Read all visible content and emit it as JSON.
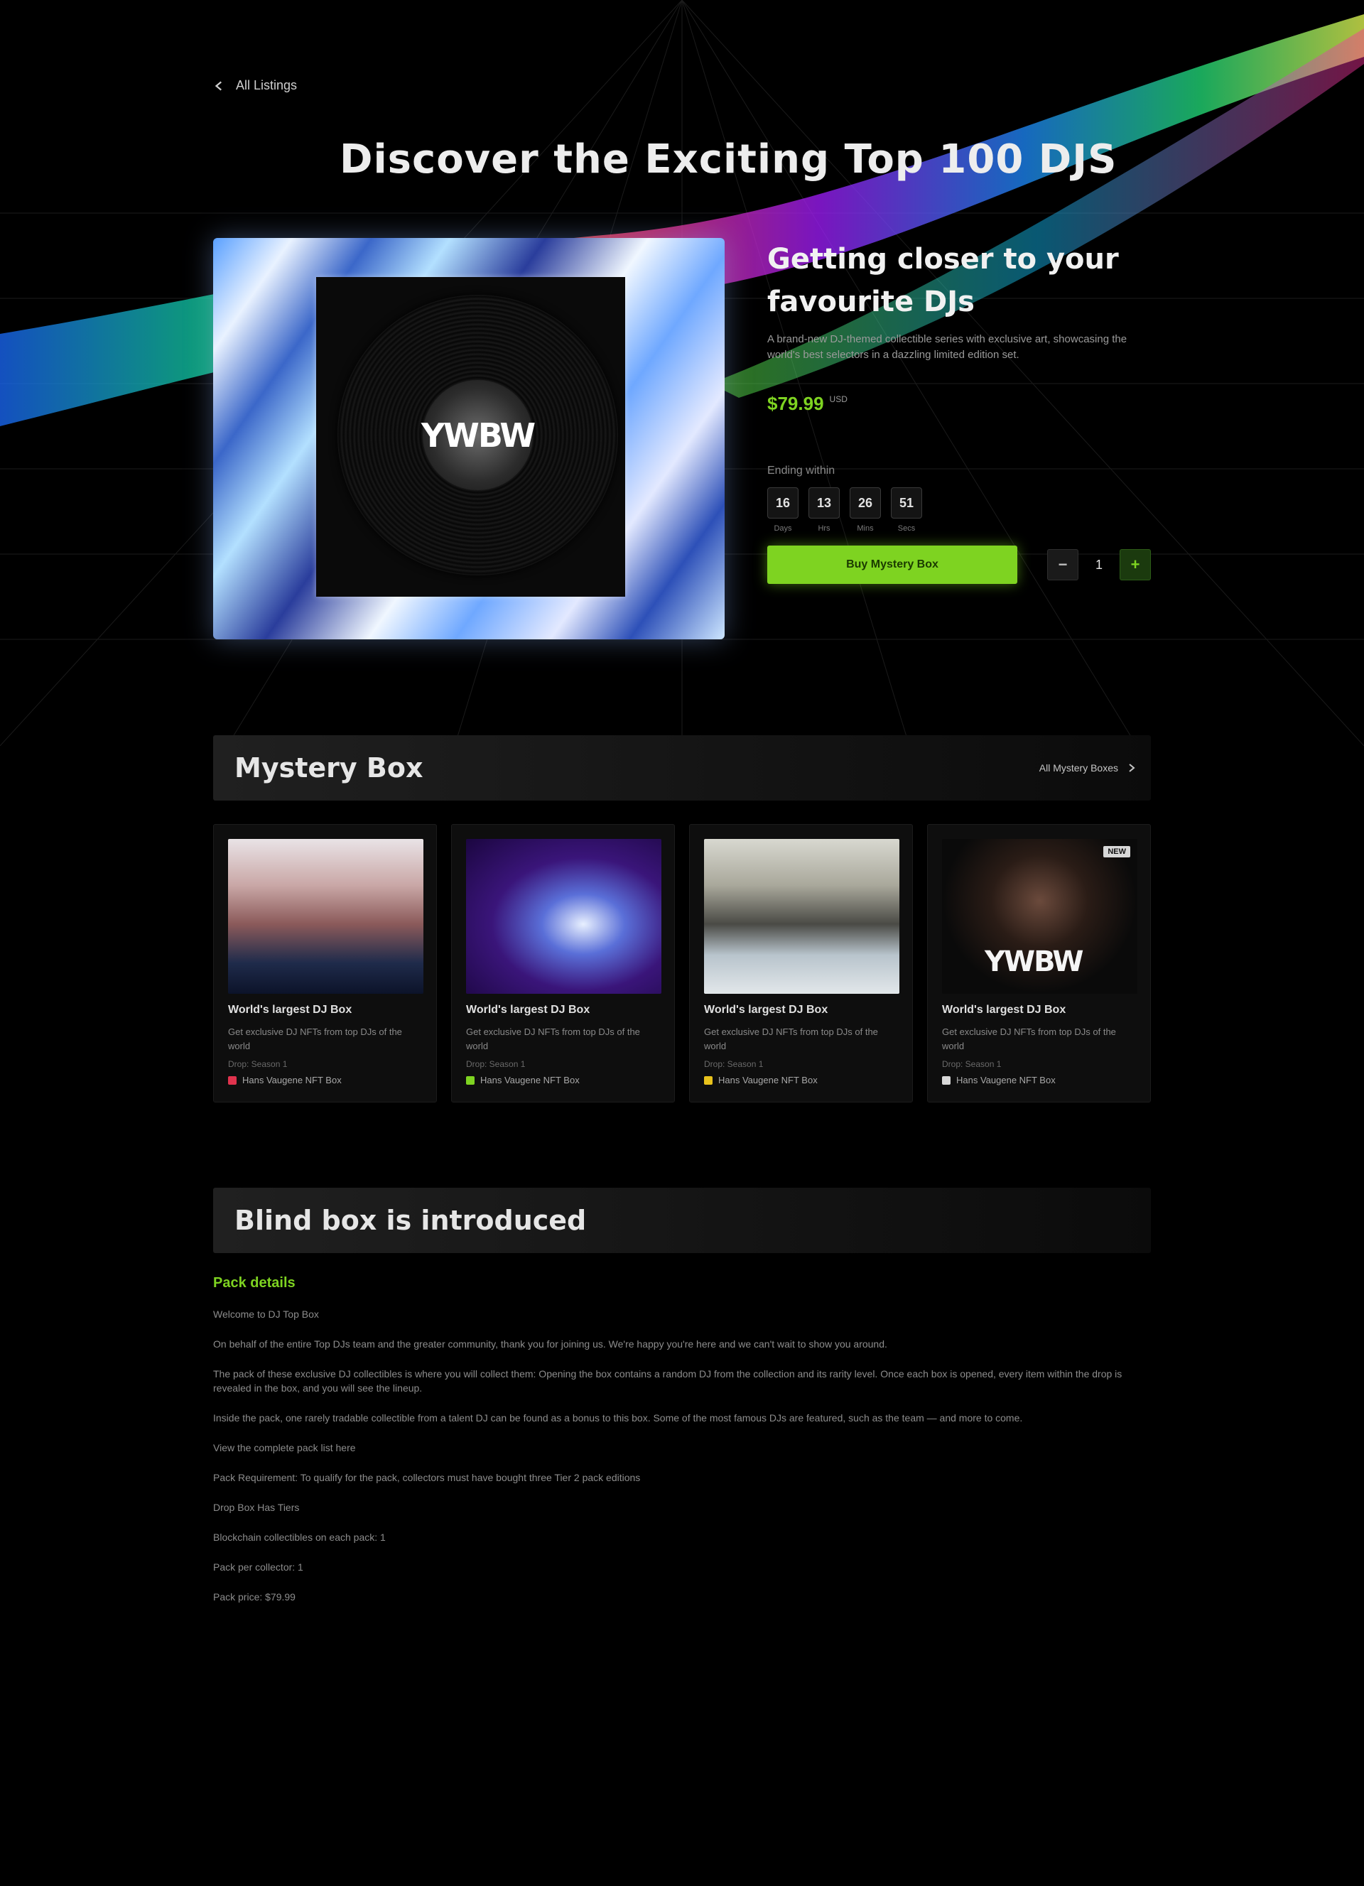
{
  "nav": {
    "back_label": "All Listings"
  },
  "hero": {
    "title": "Discover the Exciting Top 100 DJS"
  },
  "product": {
    "cover_logo": "YWBW",
    "title": "Getting closer to your favourite DJs",
    "description": "A brand-new DJ-themed collectible series with exclusive art, showcasing the world's best selectors in a dazzling limited edition set.",
    "price": "$79.99",
    "currency": "USD",
    "countdown_label": "Ending within",
    "countdown": [
      {
        "value": "16",
        "unit": "Days"
      },
      {
        "value": "13",
        "unit": "Hrs"
      },
      {
        "value": "26",
        "unit": "Mins"
      },
      {
        "value": "51",
        "unit": "Secs"
      }
    ],
    "buy_label": "Buy Mystery Box",
    "quantity": "1",
    "minus": "−",
    "plus": "+"
  },
  "mystery": {
    "title": "Mystery Box",
    "link_label": "All Mystery Boxes",
    "cards": [
      {
        "title": "World's largest DJ Box",
        "desc": "Get exclusive DJ NFTs from top DJs of the world",
        "meta": "Drop: Season 1",
        "foot": "Hans Vaugene NFT Box"
      },
      {
        "title": "World's largest DJ Box",
        "desc": "Get exclusive DJ NFTs from top DJs of the world",
        "meta": "Drop: Season 1",
        "foot": "Hans Vaugene NFT Box"
      },
      {
        "title": "World's largest DJ Box",
        "desc": "Get exclusive DJ NFTs from top DJs of the world",
        "meta": "Drop: Season 1",
        "foot": "Hans Vaugene NFT Box"
      },
      {
        "title": "World's largest DJ Box",
        "desc": "Get exclusive DJ NFTs from top DJs of the world",
        "meta": "Drop: Season 1",
        "foot": "Hans Vaugene NFT Box",
        "tag": "NEW",
        "logo": "YWBW"
      }
    ],
    "dot_colors": [
      "#e0334d",
      "#7ed321",
      "#e8c21c",
      "#d8d8d8"
    ]
  },
  "blind": {
    "title": "Blind box is introduced",
    "details_title": "Pack details",
    "lines": [
      "Welcome to DJ Top Box",
      "On behalf of the entire Top DJs team and the greater community, thank you for joining us. We're happy you're here and we can't wait to show you around.",
      "The pack of these exclusive DJ collectibles is where you will collect them: Opening the box contains a random DJ from the collection and its rarity level. Once each box is opened, every item within the drop is revealed in the box, and you will see the lineup.",
      "Inside the pack, one rarely tradable collectible from a talent DJ can be found as a bonus to this box. Some of the most famous DJs are featured, such as the team — and more to come.",
      "View the complete pack list here",
      "Pack Requirement: To qualify for the pack, collectors must have bought three Tier 2 pack editions",
      "Drop Box Has Tiers",
      "Blockchain collectibles on each pack: 1",
      "Pack per collector: 1",
      "Pack price: $79.99"
    ]
  }
}
